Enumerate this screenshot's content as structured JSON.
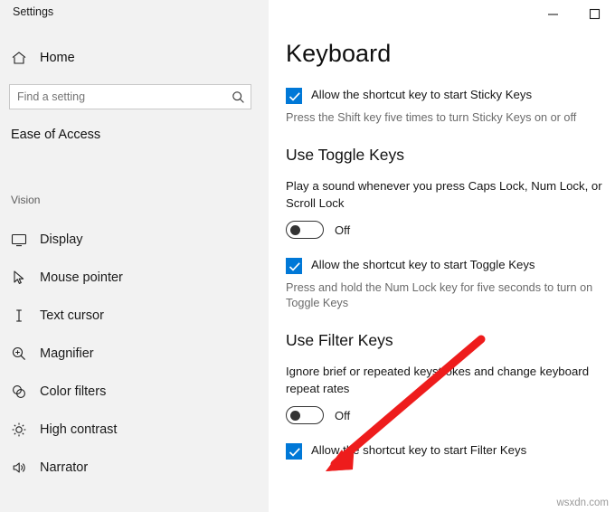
{
  "window": {
    "app_title": "Settings",
    "titlebar_buttons": [
      {
        "name": "minimize",
        "glyph": "─"
      },
      {
        "name": "maximize",
        "glyph": "□"
      }
    ]
  },
  "sidebar": {
    "home_label": "Home",
    "search": {
      "placeholder": "Find a setting",
      "value": "",
      "icon": "search-icon"
    },
    "category": "Ease of Access",
    "group_label": "Vision",
    "items": [
      {
        "label": "Display",
        "icon": "monitor-icon"
      },
      {
        "label": "Mouse pointer",
        "icon": "cursor-icon"
      },
      {
        "label": "Text cursor",
        "icon": "text-cursor-icon"
      },
      {
        "label": "Magnifier",
        "icon": "magnifier-icon"
      },
      {
        "label": "Color filters",
        "icon": "color-filters-icon"
      },
      {
        "label": "High contrast",
        "icon": "high-contrast-icon"
      },
      {
        "label": "Narrator",
        "icon": "narrator-icon"
      }
    ]
  },
  "main": {
    "page_title": "Keyboard",
    "sticky_keys": {
      "checkbox_label": "Allow the shortcut key to start Sticky Keys",
      "checked": true,
      "hint": "Press the Shift key five times to turn Sticky Keys on or off"
    },
    "toggle_keys": {
      "heading": "Use Toggle Keys",
      "description": "Play a sound whenever you press Caps Lock, Num Lock, or Scroll Lock",
      "toggle_state": "Off",
      "checkbox_label": "Allow the shortcut key to start Toggle Keys",
      "checked": true,
      "hint": "Press and hold the Num Lock key for five seconds to turn on Toggle Keys"
    },
    "filter_keys": {
      "heading": "Use Filter Keys",
      "description": "Ignore brief or repeated keystrokes and change keyboard repeat rates",
      "toggle_state": "Off",
      "checkbox_label": "Allow the shortcut key to start Filter Keys",
      "checked": true
    }
  },
  "annotation": {
    "arrow_color": "#ee1c1c",
    "watermark": "wsxdn.com"
  },
  "colors": {
    "accent": "#0078d7",
    "sidebar_bg": "#f2f2f2",
    "text": "#161616",
    "hint": "#6b6b6b"
  }
}
